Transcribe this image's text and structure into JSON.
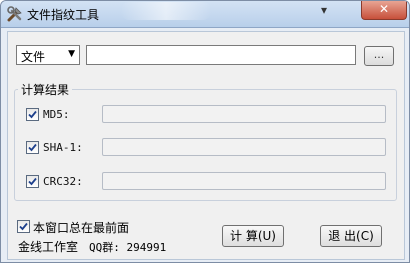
{
  "window": {
    "title": "文件指纹工具",
    "minimize_glyph": "▾",
    "close_glyph": "✕"
  },
  "source": {
    "type_selected": "文件",
    "path_value": "",
    "browse_label": "..."
  },
  "results": {
    "group_title": "计算结果",
    "rows": [
      {
        "label": "MD5:",
        "checked": true,
        "value": ""
      },
      {
        "label": "SHA-1:",
        "checked": true,
        "value": ""
      },
      {
        "label": "CRC32:",
        "checked": true,
        "value": ""
      }
    ]
  },
  "options": {
    "always_on_top_label": "本窗口总在最前面",
    "always_on_top_checked": true
  },
  "footer": {
    "studio": "金线工作室",
    "qq": "QQ群: 294991"
  },
  "buttons": {
    "calc_label": "计 算(U)",
    "exit_label": "退 出(C)"
  },
  "colors": {
    "check_mark": "#1c3f8c",
    "titlebar": "#c3d7ef",
    "close_button": "#c7503b"
  }
}
